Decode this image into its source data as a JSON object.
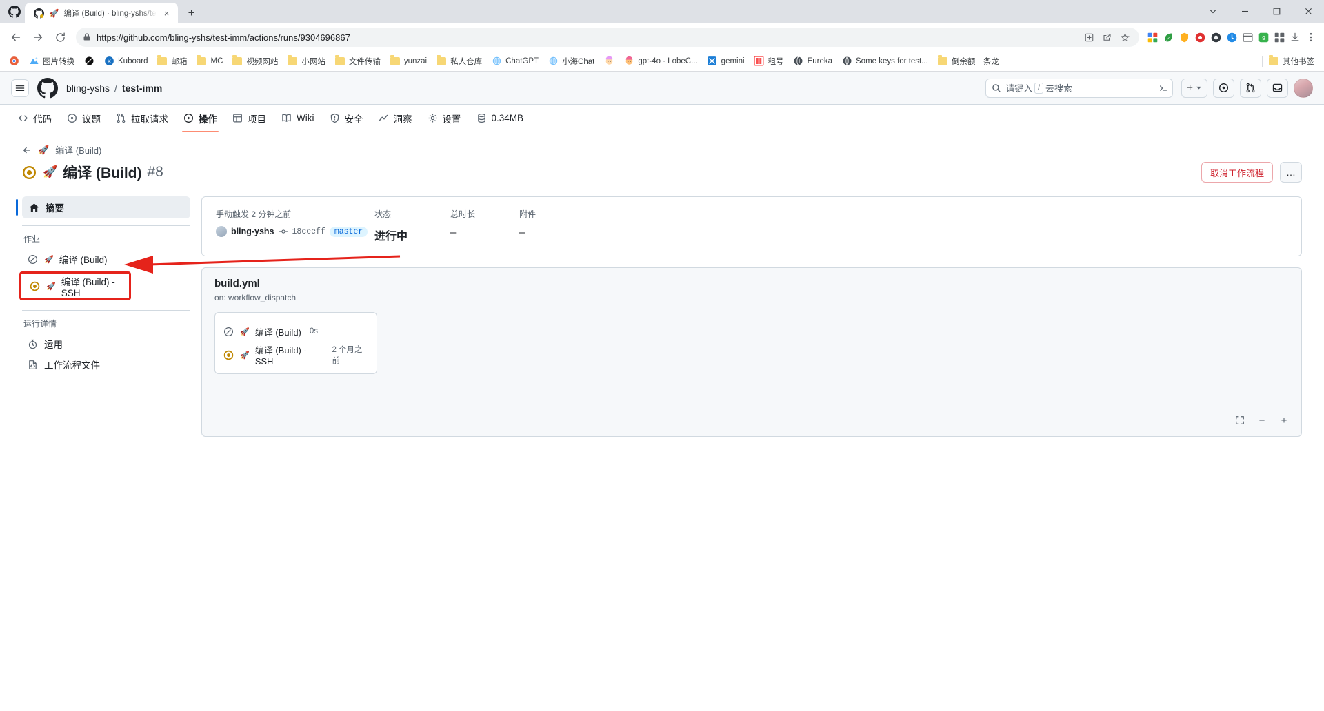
{
  "browser": {
    "tab": {
      "title": "编译 (Build) · bling-yshs/te",
      "favicon": "github-icon",
      "close_label": "×"
    },
    "new_tab_label": "+",
    "window_controls": [
      "minimize",
      "maximize",
      "close"
    ],
    "nav": {
      "back": "back-icon",
      "forward": "forward-icon",
      "reload": "reload-icon"
    },
    "omnibox": {
      "url": "https://github.com/bling-yshs/test-imm/actions/runs/9304696867",
      "lock": "lock-icon",
      "icons": [
        "share-icon",
        "install-icon",
        "bookmark-star-icon"
      ]
    },
    "bookmarks": [
      {
        "label": "",
        "icon": "chrome-icon"
      },
      {
        "label": "图片转换",
        "icon": "image-icon"
      },
      {
        "label": "",
        "icon": "black-circle-icon"
      },
      {
        "label": "Kuboard",
        "icon": "kuboard-icon"
      },
      {
        "label": "邮箱",
        "icon": "folder-icon"
      },
      {
        "label": "MC",
        "icon": "folder-icon"
      },
      {
        "label": "视频网站",
        "icon": "folder-icon"
      },
      {
        "label": "小网站",
        "icon": "folder-icon"
      },
      {
        "label": "文件传输",
        "icon": "folder-icon"
      },
      {
        "label": "yunzai",
        "icon": "folder-icon"
      },
      {
        "label": "私人仓库",
        "icon": "folder-icon"
      },
      {
        "label": "ChatGPT",
        "icon": "openai-icon"
      },
      {
        "label": "小海Chat",
        "icon": "openai-icon"
      },
      {
        "label": "",
        "icon": "emoji-face-icon"
      },
      {
        "label": "gpt-4o · LobeC...",
        "icon": "emoji-face2-icon"
      },
      {
        "label": "gemini",
        "icon": "gemini-icon"
      },
      {
        "label": "租号",
        "icon": "zuhao-icon"
      },
      {
        "label": "Eureka",
        "icon": "globe-icon"
      },
      {
        "label": "Some keys for test...",
        "icon": "globe-icon"
      },
      {
        "label": "倒余额一条龙",
        "icon": "folder-icon"
      }
    ],
    "other_bookmarks": {
      "label": "其他书签",
      "icon": "folder-icon"
    }
  },
  "github": {
    "header": {
      "menu": "hamburger-icon",
      "logo": "github-mark-icon",
      "owner": "bling-yshs",
      "separator": "/",
      "repo": "test-imm",
      "search_placeholder": "请键入",
      "search_key": "/",
      "search_suffix": "去搜索",
      "terminal_icon": ">_",
      "create_new": "+",
      "issues_icon": "issue-opened-icon",
      "pulls_icon": "git-pull-request-icon",
      "inbox_icon": "inbox-icon",
      "avatar": "user-avatar"
    },
    "nav": [
      {
        "label": "代码",
        "icon": "code-icon",
        "active": false
      },
      {
        "label": "议题",
        "icon": "issue-opened-icon",
        "active": false
      },
      {
        "label": "拉取请求",
        "icon": "git-pull-request-icon",
        "active": false
      },
      {
        "label": "操作",
        "icon": "play-circle-icon",
        "active": true
      },
      {
        "label": "项目",
        "icon": "table-icon",
        "active": false
      },
      {
        "label": "Wiki",
        "icon": "book-icon",
        "active": false
      },
      {
        "label": "安全",
        "icon": "shield-icon",
        "active": false
      },
      {
        "label": "洞察",
        "icon": "graph-icon",
        "active": false
      },
      {
        "label": "设置",
        "icon": "gear-icon",
        "active": false
      },
      {
        "label": "0.34MB",
        "icon": "database-icon",
        "active": false
      }
    ],
    "run": {
      "back_label": "编译 (Build)",
      "back_icon": "arrow-left-icon",
      "rocket_icon": "rocket-icon",
      "title": "编译 (Build)",
      "run_number": "#8",
      "status_icon": "in-progress-icon",
      "cancel_button": "取消工作流程",
      "more_button": "…"
    },
    "sidebar": {
      "summary": {
        "label": "摘要",
        "icon": "home-icon"
      },
      "jobs_title": "作业",
      "jobs": [
        {
          "label": "编译 (Build)",
          "icon": "skipped-icon",
          "rocket": "rocket-icon",
          "highlighted": false
        },
        {
          "label": "编译 (Build) - SSH",
          "icon": "in-progress-icon",
          "rocket": "rocket-icon",
          "highlighted": true
        }
      ],
      "details_title": "运行详情",
      "details": [
        {
          "label": "运用",
          "icon": "stopwatch-icon"
        },
        {
          "label": "工作流程文件",
          "icon": "file-code-icon"
        }
      ]
    },
    "summary_card": {
      "trigger_text": "手动触发 2 分钟之前",
      "actor": "bling-yshs",
      "commit_icon": "commit-icon",
      "sha": "18ceeff",
      "branch": "master",
      "status_label": "状态",
      "status_value": "进行中",
      "duration_label": "总时长",
      "duration_value": "–",
      "artifacts_label": "附件",
      "artifacts_value": "–"
    },
    "graph": {
      "workflow_file": "build.yml",
      "on_event": "on: workflow_dispatch",
      "jobs": [
        {
          "label": "编译 (Build)",
          "icon": "skipped-icon",
          "rocket": "rocket-icon",
          "time": "0s"
        },
        {
          "label": "编译 (Build) - SSH",
          "icon": "in-progress-icon",
          "rocket": "rocket-icon",
          "time": "2 个月之前"
        }
      ],
      "controls": {
        "fullscreen": "fullscreen-icon",
        "zoom_out": "−",
        "zoom_in": "+"
      }
    },
    "annotation": {
      "color": "#e5231b",
      "type": "red-box-with-arrow",
      "target": "编译 (Build) - SSH"
    }
  }
}
